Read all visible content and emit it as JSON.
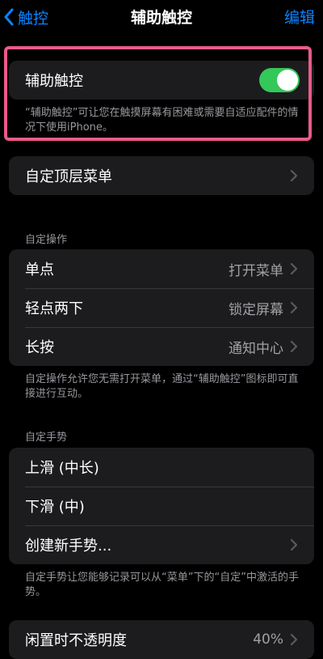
{
  "nav": {
    "back_label": "触控",
    "title": "辅助触控",
    "edit_label": "编辑"
  },
  "assistive": {
    "label": "辅助触控",
    "enabled": true,
    "description": "“辅助触控”可让您在触摸屏幕有困难或需要自适应配件的情况下使用iPhone。"
  },
  "top_menu": {
    "label": "自定顶层菜单"
  },
  "custom_actions": {
    "header": "自定操作",
    "items": [
      {
        "label": "单点",
        "value": "打开菜单"
      },
      {
        "label": "轻点两下",
        "value": "锁定屏幕"
      },
      {
        "label": "长按",
        "value": "通知中心"
      }
    ],
    "footer": "自定操作允许您无需打开菜单，通过“辅助触控”图标即可直接进行互动。"
  },
  "custom_gestures": {
    "header": "自定手势",
    "items": [
      {
        "label": "上滑 (中长)"
      },
      {
        "label": "下滑 (中)"
      },
      {
        "label": "创建新手势..."
      }
    ],
    "footer": "自定手势让您能够记录可以从“菜单”下的“自定”中激活的手势。"
  },
  "idle_opacity": {
    "label": "闲置时不透明度",
    "value": "40%"
  },
  "colors": {
    "accent": "#0a84ff",
    "toggle_on": "#34c759",
    "highlight": "#e95b8a",
    "cell": "#1c1c1e"
  }
}
